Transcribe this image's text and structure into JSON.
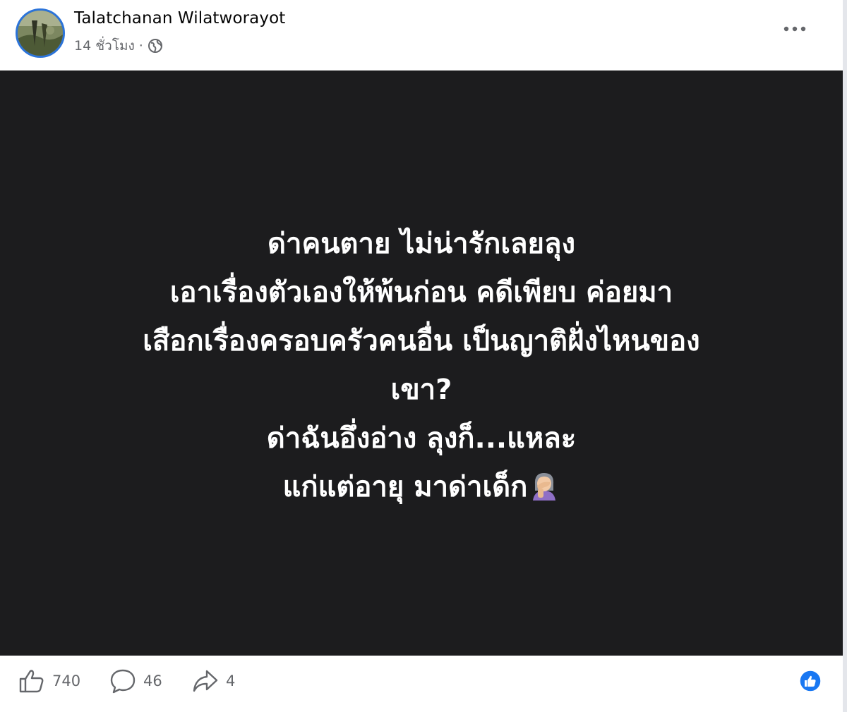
{
  "header": {
    "author_name": "Talatchanan Wilatworayot",
    "timestamp": "14 ชั่วโมง",
    "separator": "·",
    "privacy_icon": "globe-icon",
    "more_icon": "more-options-icon"
  },
  "post": {
    "background_color": "#1c1c1e",
    "text_color": "#ffffff",
    "lines": [
      "ด่าคนตาย ไม่น่ารักเลยลุง",
      "เอาเรื่องตัวเองให้พ้นก่อน คดีเพียบ ค่อยมา",
      "เสือกเรื่องครอบครัวคนอื่น เป็นญาติฝั่งไหนของ",
      "เขา?",
      "ด่าฉันอึ่งอ่าง ลุงก็...แหละ",
      "แก่แต่อายุ มาด่าเด็ก"
    ],
    "trailing_emoji_icon": "woman-facepalming-icon"
  },
  "footer": {
    "likes": "740",
    "comments": "46",
    "shares": "4",
    "like_icon": "thumbs-up-icon",
    "comment_icon": "comment-icon",
    "share_icon": "share-icon",
    "reaction_badge_icon": "like-reaction-badge-icon",
    "accent_color": "#1877f2"
  }
}
